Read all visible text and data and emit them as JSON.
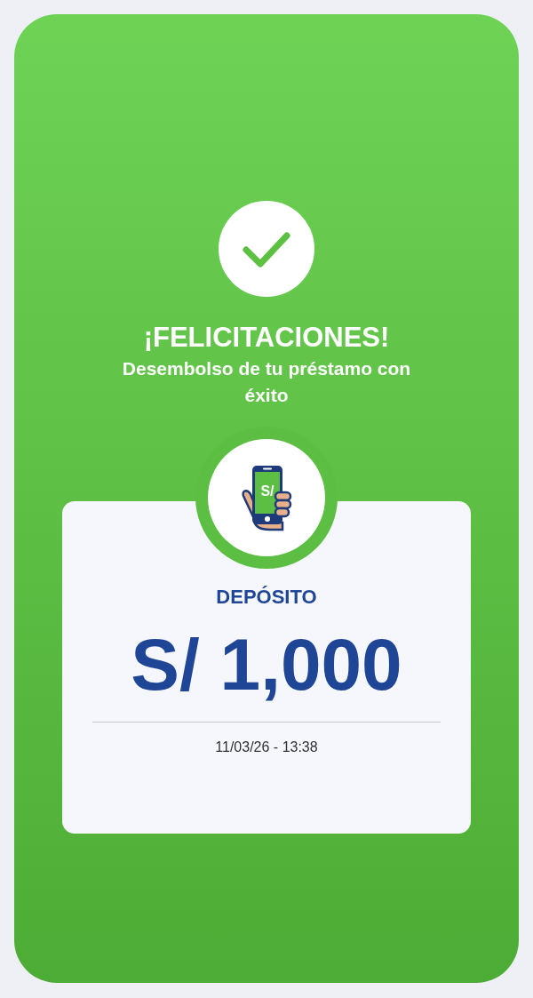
{
  "title": "¡FELICITACIONES!",
  "subtitle": "Desembolso de tu préstamo con éxito",
  "phone_symbol": "S/",
  "card": {
    "label": "DEPÓSITO",
    "amount": "S/ 1,000",
    "datetime": "11/03/26 - 13:38"
  }
}
